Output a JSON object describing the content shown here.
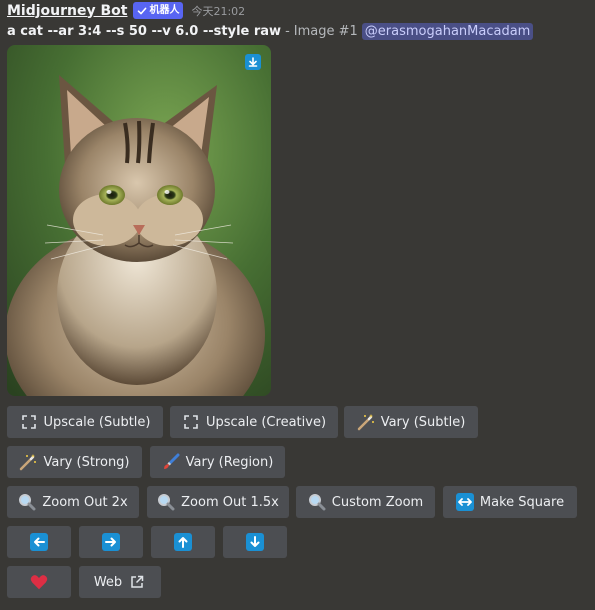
{
  "theme": {
    "background": "#393835",
    "accent": "#5865f2",
    "button_bg": "#4c4e52",
    "arrow_blue": "#1a90d4"
  },
  "message": {
    "author": "Midjourney Bot",
    "badge": {
      "icon": "checkmark-icon",
      "label": "机器人"
    },
    "timestamp": "今天21:02",
    "prompt": "a cat --ar 3:4 --s 50 --v 6.0 --style raw",
    "separator": "-",
    "image_label": "Image #1",
    "mention": "@erasmogahanMacadam",
    "image": {
      "alt_icon": "download-icon"
    }
  },
  "buttons": {
    "upscale_subtle": {
      "label": "Upscale (Subtle)",
      "icon": "expand-icon"
    },
    "upscale_creative": {
      "label": "Upscale (Creative)",
      "icon": "expand-icon"
    },
    "vary_subtle": {
      "label": "Vary (Subtle)",
      "icon": "magic-wand-icon"
    },
    "vary_strong": {
      "label": "Vary (Strong)",
      "icon": "magic-wand-icon"
    },
    "vary_region": {
      "label": "Vary (Region)",
      "icon": "paintbrush-icon"
    },
    "zoom_out_2x": {
      "label": "Zoom Out 2x",
      "icon": "magnifier-icon"
    },
    "zoom_out_15x": {
      "label": "Zoom Out 1.5x",
      "icon": "magnifier-icon"
    },
    "custom_zoom": {
      "label": "Custom Zoom",
      "icon": "magnifier-icon"
    },
    "make_square": {
      "label": "Make Square",
      "icon": "left-right-arrow-icon"
    },
    "pan_left": {
      "icon": "arrow-left-icon"
    },
    "pan_right": {
      "icon": "arrow-right-icon"
    },
    "pan_up": {
      "icon": "arrow-up-icon"
    },
    "pan_down": {
      "icon": "arrow-down-icon"
    },
    "favorite": {
      "icon": "heart-icon"
    },
    "web": {
      "label": "Web",
      "icon": "external-link-icon"
    }
  }
}
